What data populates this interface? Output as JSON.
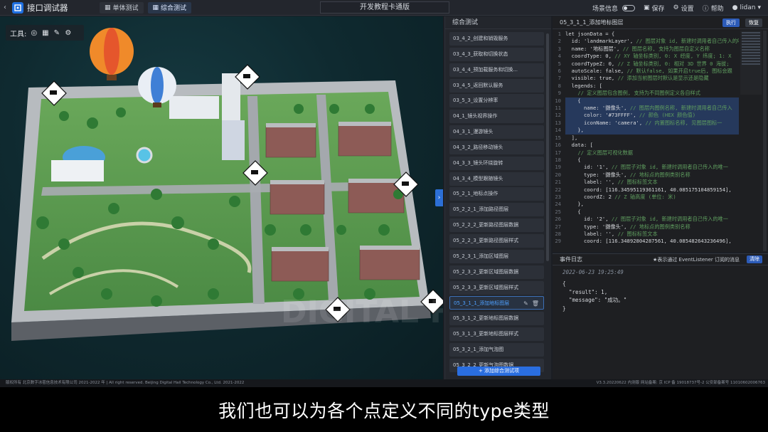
{
  "app": {
    "title": "接口调试器"
  },
  "tabs": [
    {
      "label": "单体测试"
    },
    {
      "label": "综合测试"
    }
  ],
  "center_title": "开发教程卡通版",
  "top_right": {
    "scene_info": "场景信息",
    "save": "保存",
    "settings": "设置",
    "help": "帮助",
    "user": "lidan"
  },
  "map": {
    "tools_label": "工具:"
  },
  "mid_panel": {
    "header": "综合测试",
    "items": [
      "03_4_2_创建和销毁服务",
      "03_4_3_获取和切换状态",
      "03_4_4_预加载服务和切换...",
      "03_4_5_返回默认服务",
      "03_5_3_设置分辨率",
      "04_1_镜头视界操作",
      "04_3_1_漫游镜头",
      "04_3_2_路径移动镜头",
      "04_3_3_镜头环绕旋转",
      "04_3_4_模型跟随镜头",
      "05_2_1_地标点操作",
      "05_2_2_1_添加路径图层",
      "05_2_2_2_更新路径图层数据",
      "05_2_2_3_更新路径图层样式",
      "05_2_3_1_添加区域图层",
      "05_2_3_2_更新区域图层数据",
      "05_2_3_3_更新区域图层样式",
      "05_3_1_1_添加地标图层",
      "05_3_1_2_更新地标图层数据",
      "05_3_1_3_更新地标图层样式",
      "05_3_2_1_添加气泡图",
      "05_3_2_2_更新气泡图数据"
    ],
    "active_index": 17,
    "add_button": "+ 添加综合测试项"
  },
  "code_panel": {
    "title": "05_3_1_1_添加地标图层",
    "run": "执行",
    "reset": "恢复",
    "lines": [
      "let jsonData = {",
      "  id: 'landmarkLayer', // 图层对象 id, 新建时调用者自己传入的唯一",
      "  name: '地标图层', // 图层名称, 支持为图层自定义名称",
      "  coordType: 0, // XY 轴坐标类别, 0: X 经度, Y 纬度; 1: X",
      "  coordTypeZ: 0, // Z 轴坐标类别, 0: 相对 3D 世界 0 海拔;",
      "  autoScale: false, // 默认false, 如果开启true后, 图标会跟",
      "  visible: true, // 添加当前图层时默认是显示还是隐藏",
      "  legends: [",
      "    // 定义图层包含图例, 支持为不同图例定义各自样式",
      "    {",
      "      name: '摄像头', // 图层内图例名称, 新建时调用者自己传入",
      "      color: '#73FFFF', // 颜色 (HEX 颜色值)",
      "      iconName: 'camera', // 内置图标名称, 见图层图标一",
      "    },",
      "  ],",
      "  data: [",
      "    // 定义图层可视化数据",
      "    {",
      "      id: '1', // 图层子对象 id, 新建时调用者自己传入的唯一",
      "      type: '摄像头', // 地标点的图例类别名称",
      "      label: '', // 图标标签文本",
      "      coord: [116.34595119361161, 40.085175104859154],",
      "      coordZ: 2 // Z 轴高度 (单位: 米)",
      "    },",
      "    {",
      "      id: '2', // 图层子对象 id, 新建时调用者自己传入的唯一",
      "      type: '摄像头', // 地标点的图例类别名称",
      "      label: '', // 图标标签文本",
      "      coord: [116.34892804287561, 40.085482643236496],"
    ]
  },
  "event_log": {
    "title": "事件日志",
    "hint": "★表示通过 EventListener 订阅的消息",
    "clear": "清除",
    "time": "2022-06-23 19:25:49",
    "body": "{\n  \"result\": 1,\n  \"message\": \"成功。\"\n}"
  },
  "footer": {
    "left": "版权所有 北京数字冰雹信息技术有限公司 2021-2022 年 | All right reserved. Beijing Digital Hail Technology Co., Ltd. 2021-2022",
    "right": "V3.3.20220622 内测版   网站备案: 京 ICP 备 19018737号-2 公安部备案号 11010602006763"
  },
  "subtitle": "我们也可以为各个点定义不同的type类型",
  "watermark": "DIGITAL HAIL",
  "colors": {
    "accent": "#2a6ee0",
    "highlight_text": "#4ea0ff",
    "code_bg": "#1e1f22"
  }
}
